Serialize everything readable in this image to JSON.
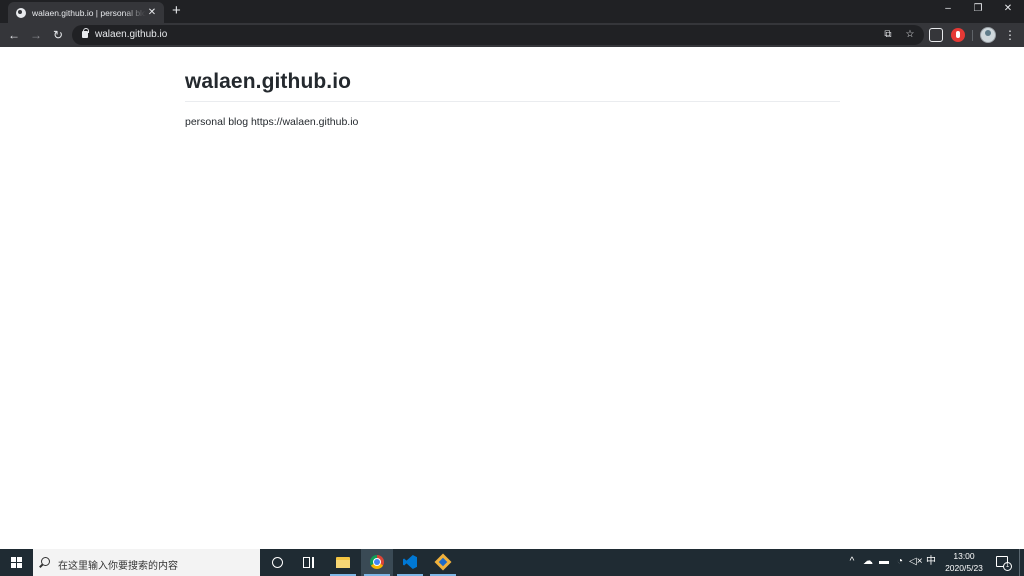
{
  "browser": {
    "tab": {
      "title": "walaen.github.io | personal blog",
      "favicon": "globe-icon"
    },
    "address_bar": {
      "url": "walaen.github.io"
    },
    "window_controls": {
      "minimize": "–",
      "restore": "❐",
      "close": "✕"
    }
  },
  "page": {
    "title": "walaen.github.io",
    "description": "personal blog https://walaen.github.io"
  },
  "taskbar": {
    "search_placeholder": "在这里输入你要搜索的内容",
    "tray": {
      "ime": "中",
      "time": "13:00",
      "date": "2020/5/23",
      "notification_count": "1"
    },
    "pinned_apps": [
      "file-explorer",
      "chrome",
      "vscode",
      "gitkraken"
    ]
  },
  "colors": {
    "chrome_dark": "#202124",
    "toolbar": "#35363a",
    "taskbar": "#1f2b33",
    "heading": "#24292e"
  }
}
